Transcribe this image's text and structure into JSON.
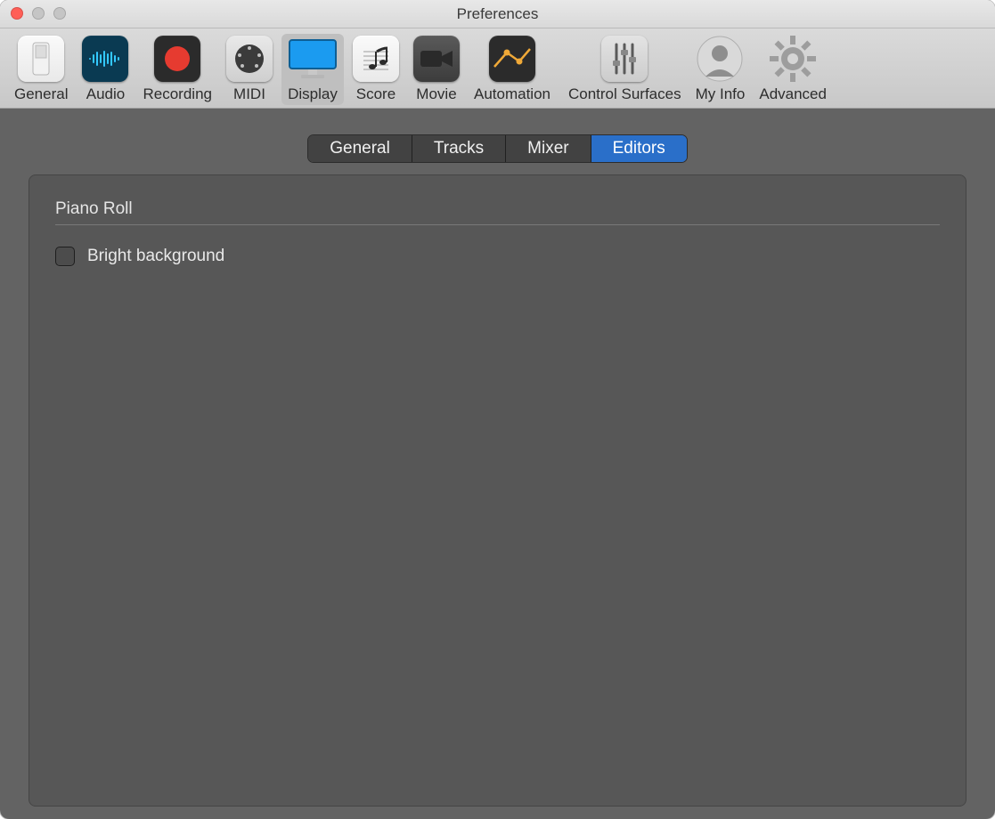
{
  "window": {
    "title": "Preferences"
  },
  "toolbar": {
    "items": [
      {
        "id": "general",
        "label": "General"
      },
      {
        "id": "audio",
        "label": "Audio"
      },
      {
        "id": "recording",
        "label": "Recording"
      },
      {
        "id": "midi",
        "label": "MIDI"
      },
      {
        "id": "display",
        "label": "Display",
        "selected": true
      },
      {
        "id": "score",
        "label": "Score"
      },
      {
        "id": "movie",
        "label": "Movie"
      },
      {
        "id": "automation",
        "label": "Automation"
      },
      {
        "id": "control-surfaces",
        "label": "Control Surfaces"
      },
      {
        "id": "my-info",
        "label": "My Info"
      },
      {
        "id": "advanced",
        "label": "Advanced"
      }
    ]
  },
  "tabs": [
    {
      "id": "general",
      "label": "General"
    },
    {
      "id": "tracks",
      "label": "Tracks"
    },
    {
      "id": "mixer",
      "label": "Mixer"
    },
    {
      "id": "editors",
      "label": "Editors",
      "active": true
    }
  ],
  "section": {
    "title": "Piano Roll",
    "options": [
      {
        "id": "bright-background",
        "label": "Bright background",
        "checked": false
      }
    ]
  },
  "colors": {
    "accent": "#2a6fc9",
    "body_bg": "#636363",
    "panel_bg": "#575757"
  }
}
